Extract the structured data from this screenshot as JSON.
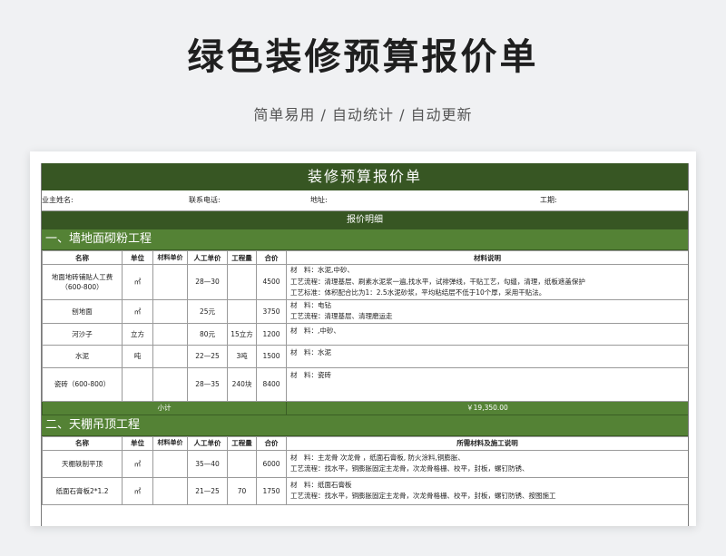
{
  "header": {
    "title": "绿色装修预算报价单",
    "subtitle": "简单易用 / 自动统计 / 自动更新"
  },
  "sheet": {
    "title": "装修预算报价单",
    "info": {
      "owner_label": "业主姓名:",
      "phone_label": "联系电话:",
      "address_label": "地址:",
      "period_label": "工期:"
    },
    "detail_label": "报价明细",
    "sections": [
      {
        "name": "一、墙地面砌粉工程",
        "columns": [
          "名称",
          "单位",
          "材料单价",
          "人工单价",
          "工程量",
          "合价",
          "材料说明"
        ],
        "rows": [
          {
            "name": "地面地砖铺贴人工费（600-800）",
            "unit": "㎡",
            "material_price": "",
            "labor_price": "28—30",
            "qty": "",
            "total": "4500",
            "desc": [
              "材　料：水泥,中砂、",
              "工艺流程：清理基层、刷素水泥浆一遍,找水平，试排弹线，干贴工艺，勾缝，清理，纸板遮盖保护",
              "工艺标准：体积配合比为1：2.5水泥砂浆，平均粘结层不低于10个厚，采用干贴法。"
            ]
          },
          {
            "name": "刨地面",
            "unit": "㎡",
            "material_price": "",
            "labor_price": "25元",
            "qty": "",
            "total": "3750",
            "desc": [
              "材　料：电钻",
              "工艺流程：清理基层、清理磨运走"
            ]
          },
          {
            "name": "河沙子",
            "unit": "立方",
            "material_price": "",
            "labor_price": "80元",
            "qty": "15立方",
            "total": "1200",
            "desc": [
              "材　料：,中砂、"
            ]
          },
          {
            "name": "水泥",
            "unit": "吨",
            "material_price": "",
            "labor_price": "22—25",
            "qty": "3吨",
            "total": "1500",
            "desc": [
              "材　料：水泥"
            ]
          },
          {
            "name": "瓷砖（600-800）",
            "unit": "",
            "material_price": "",
            "labor_price": "28—35",
            "qty": "240块",
            "total": "8400",
            "desc": [
              "材　料：瓷砖"
            ]
          }
        ],
        "subtotal_label": "小计",
        "subtotal_value": "￥19,350.00"
      },
      {
        "name": "二、天棚吊顶工程",
        "columns": [
          "名称",
          "单位",
          "材料单价",
          "人工单价",
          "工程量",
          "合价",
          "所需材料及施工说明"
        ],
        "rows": [
          {
            "name": "天棚轶制平顶",
            "unit": "㎡",
            "material_price": "",
            "labor_price": "35—40",
            "qty": "",
            "total": "6000",
            "desc": [
              "材　料：主龙骨 次龙骨 ，纸面石膏板, 防火涂料,铜膨胀、",
              "工艺流程：找水平，铜膨胀固定主龙骨，次龙骨格栅、校平，封板，螺钉防锈、"
            ]
          },
          {
            "name": "纸面石膏板2*1.2",
            "unit": "㎡",
            "material_price": "",
            "labor_price": "21—25",
            "qty": "70",
            "total": "1750",
            "desc": [
              "材　料：纸面石膏板",
              "工艺流程：找水平，铜膨胀固定主龙骨，次龙骨格栅、校平，封板，螺钉防锈、按图施工"
            ]
          }
        ]
      }
    ]
  }
}
